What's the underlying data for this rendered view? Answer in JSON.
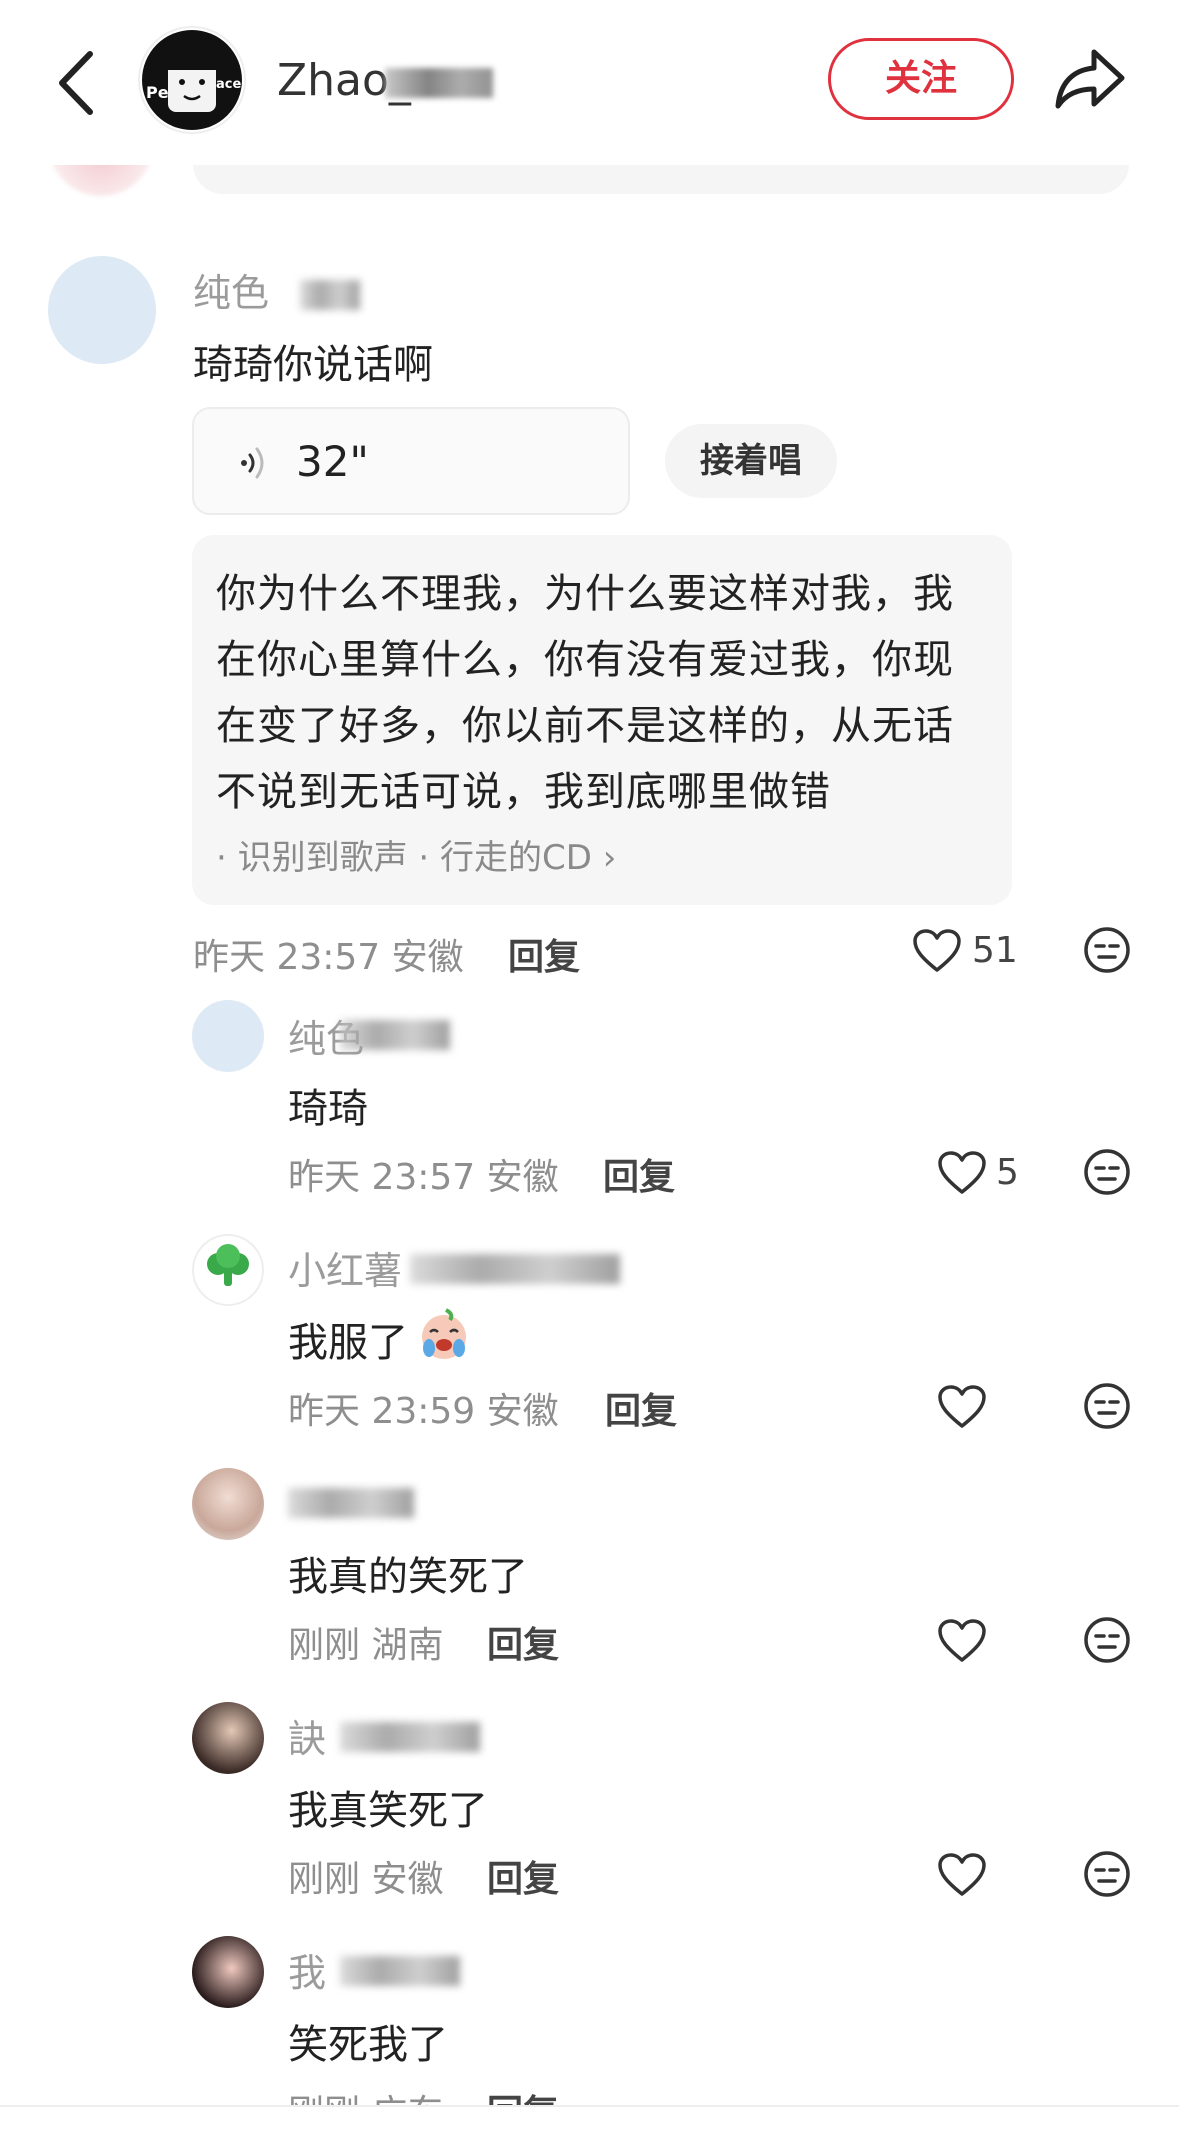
{
  "header": {
    "username": "Zhao_",
    "follow_label": "关注"
  },
  "main_comment": {
    "username": "纯色",
    "text": "琦琦你说话啊",
    "voice_duration": "32\"",
    "sing_along_label": "接着唱",
    "lyrics": [
      "你为什么不理我，为什么要这样对我，我",
      "在你心里算什么，你有没有爱过我，你现",
      "在变了好多，你以前不是这样的，从无话",
      "不说到无话可说，我到底哪里做错"
    ],
    "song_source": "· 识别到歌声 · 行走的CD ›",
    "meta": "昨天 23:57 安徽",
    "reply_label": "回复",
    "likes": "51"
  },
  "replies": [
    {
      "username": "纯色",
      "text": "琦琦",
      "meta": "昨天 23:57 安徽",
      "reply_label": "回复",
      "likes": "5"
    },
    {
      "username": "小红薯",
      "text": "我服了",
      "meta": "昨天 23:59 安徽",
      "reply_label": "回复",
      "likes": ""
    },
    {
      "username": "",
      "text": "我真的笑死了",
      "meta": "刚刚 湖南",
      "reply_label": "回复",
      "likes": ""
    },
    {
      "username": "訣",
      "text": "我真笑死了",
      "meta": "刚刚 安徽",
      "reply_label": "回复",
      "likes": ""
    },
    {
      "username": "我",
      "text": "笑死我了",
      "meta": "刚刚 广东",
      "reply_label": "回复",
      "likes": ""
    }
  ],
  "colors": {
    "accent": "#e0313f",
    "bubble": "#f6f6f6",
    "meta": "#8e8e8e"
  },
  "icons": [
    "back-arrow-icon",
    "share-icon",
    "voice-icon",
    "heart-icon",
    "neutral-face-icon",
    "broccoli-icon",
    "crying-face-emoji"
  ]
}
